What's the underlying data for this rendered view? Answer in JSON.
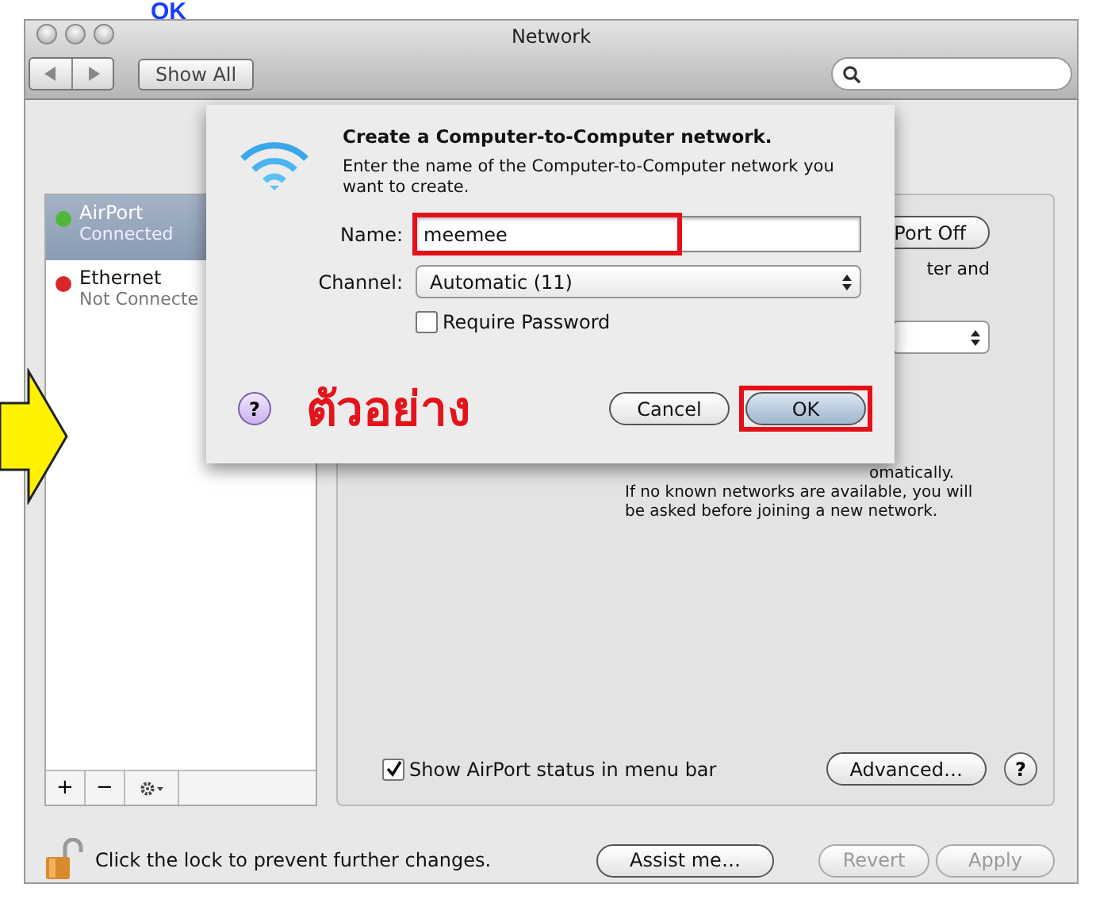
{
  "caption": {
    "text": "OK"
  },
  "window": {
    "title": "Network"
  },
  "toolbar": {
    "show_all": "Show All"
  },
  "services": [
    {
      "name": "AirPort",
      "status": "Connected",
      "selected": true,
      "color": "#4fb83a"
    },
    {
      "name": "Ethernet",
      "status": "Not Connecte",
      "selected": false,
      "color": "#d8262b"
    }
  ],
  "service_tools": [
    "+",
    "−"
  ],
  "panel": {
    "power_button": "Port Off",
    "partial_text": "ter and",
    "note_lines": [
      "omatically.",
      "If no known networks are available, you will",
      "be asked before joining a new network."
    ],
    "show_status": {
      "label": "Show AirPort status in menu bar",
      "checked": true
    },
    "advanced": "Advanced…",
    "help": "?"
  },
  "sheet": {
    "title": "Create a Computer-to-Computer network.",
    "message": "Enter the name of the Computer-to-Computer network you want to create.",
    "name_label": "Name:",
    "name_value": "meemee",
    "channel_label": "Channel:",
    "channel_value": "Automatic (11)",
    "require_password": {
      "label": "Require Password",
      "checked": false
    },
    "help": "?",
    "cancel": "Cancel",
    "ok": "OK"
  },
  "annotation": {
    "text": "ตัวอย่าง"
  },
  "footer": {
    "lock_text": "Click the lock to prevent further changes.",
    "buttons": [
      {
        "label": "Assist me…",
        "disabled": false
      },
      {
        "label": "Revert",
        "disabled": true
      },
      {
        "label": "Apply",
        "disabled": true
      }
    ]
  }
}
